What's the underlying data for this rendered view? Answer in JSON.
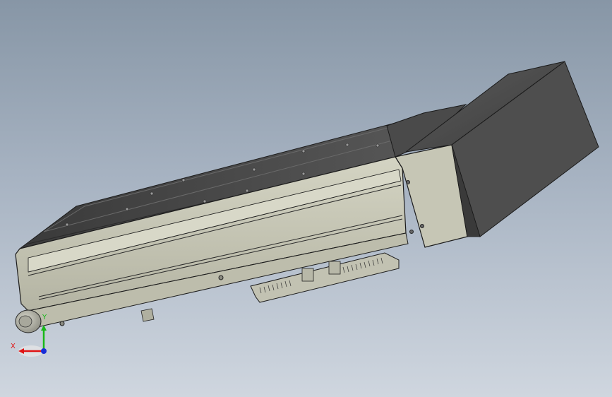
{
  "window": {
    "title": ""
  },
  "viewport": {
    "background_top": "#8796a6",
    "background_bottom": "#cfd6df",
    "model": {
      "name": "linear-actuator-module",
      "body_color": "#c7c7b6",
      "dark_color": "#4a4a4a",
      "edge_color": "#222222"
    }
  },
  "triad": {
    "x_label": "X",
    "y_label": "Y",
    "x_color": "#e01414",
    "y_color": "#18b818",
    "z_color": "#1a2ed8"
  },
  "icons": [
    "axis-triad-icon"
  ]
}
